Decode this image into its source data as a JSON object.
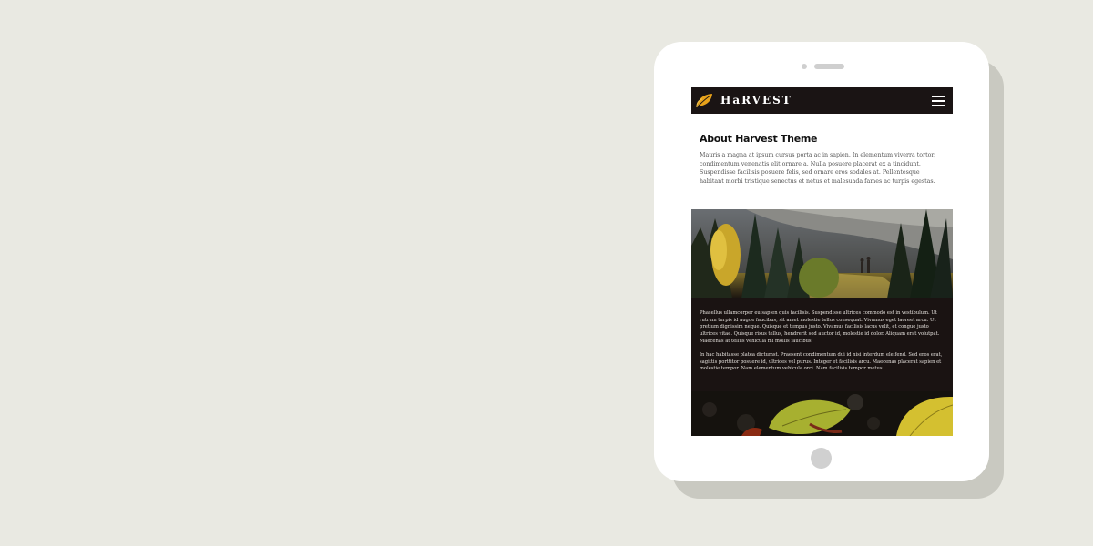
{
  "site": {
    "logo_text": "HaRVEST",
    "logo_icon": "leaf-icon",
    "menu_icon": "hamburger-menu-icon"
  },
  "about": {
    "title": "About Harvest Theme",
    "body": "Mauris a magna at ipsum cursus porta ac in sapien. In elementum viverra tortor, condimentum venenatis elit ornare a. Nulla posuere placerat ex a tincidunt. Suspendisse facilisis posuere felis, sed ornare eros sodales at. Pellentesque habitant morbi tristique senectus et netus et malesuada fames ac turpis egestas."
  },
  "hero": {
    "paragraph_1": "Phasellus ullamcorper eu sapien quis facilisis. Suspendisse ultrices commodo est in vestibulum. Ut rutrum turpis id augue faucibus, sit amet molestie tellus consequat. Vivamus eget laoreet arcu. Ut pretium dignissim neque. Quisque et tempus justo. Vivamus facilisis lacus velit, et congue justo ultrices vitae. Quisque risus tellus, hendrerit sed auctor id, molestie id dolor. Aliquam erat volutpat. Maecenas at tellus vehicula mi mollis faucibus.",
    "paragraph_2": "In hac habitasse platea dictumst. Praesent condimentum dui id nisi interdum eleifend. Sed eros erat, sagittis porttitor posuere id, ultrices vel purus. Integer et facilisis arcu. Maecenas placerat sapien et molestie tempor. Nam elementum vehicula orci. Nam facilisis tempor metus."
  },
  "colors": {
    "page_background": "#e9e9e2",
    "header_background": "#1a1414",
    "logo_accent": "#e8a21a",
    "panel_background": "#1a1312"
  }
}
